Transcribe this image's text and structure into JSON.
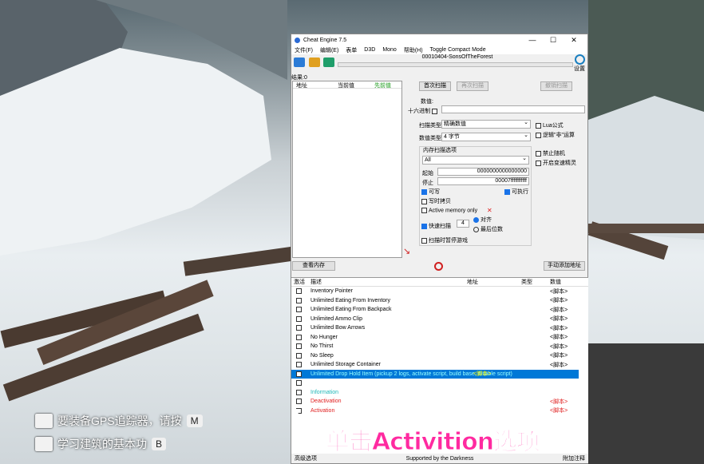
{
  "window": {
    "title": "Cheat Engine 7.5",
    "process": "00010404-SonsOfTheForest"
  },
  "menu": [
    "文件(F)",
    "编辑(E)",
    "表单",
    "D3D",
    "Mono",
    "帮助(H)",
    "Toggle Compact Mode"
  ],
  "settings_label": "设置",
  "found": "结果:0",
  "list_headers": [
    "地址",
    "当前值",
    "先前值"
  ],
  "buttons": {
    "first_scan": "首次扫描",
    "next_scan": "再次扫描",
    "undo_scan": "撤销扫描",
    "memory_view": "查看内存",
    "add_address": "手动添加地址"
  },
  "value_label": "数值:",
  "hex_label": "十六进制",
  "scan_type_label": "扫描类型",
  "scan_type": "精确数值",
  "value_type_label": "数值类型",
  "value_type": "4 字节",
  "mem_options_label": "内存扫描选项",
  "region": "All",
  "start_label": "起始",
  "start_value": "0000000000000000",
  "stop_label": "停止",
  "stop_value": "00007fffffffffff",
  "opts": {
    "writable": "可写",
    "copy_on_write": "写时拷贝",
    "executable": "可执行",
    "active_memory": "Active memory only",
    "fast_scan": "快速扫描",
    "fast_scan_value": "4",
    "align": "对齐",
    "last_digits": "最后位数",
    "pause": "扫描时暂停游戏"
  },
  "right_opts": {
    "lua": "Lua公式",
    "not": "逻辑\"非\"运算",
    "unrandomizer": "禁止随机",
    "speedhack": "开启变速精灵"
  },
  "table_headers": [
    "激活",
    "描述",
    "地址",
    "类型",
    "数值"
  ],
  "rows": [
    {
      "desc": "Inventory Pointer",
      "value": "<脚本>"
    },
    {
      "desc": "Unlimited Eating From Inventory",
      "value": "<脚本>"
    },
    {
      "desc": "Unlimited Eating From Backpack",
      "value": "<脚本>"
    },
    {
      "desc": "Unlimited Ammo Clip",
      "value": "<脚本>"
    },
    {
      "desc": "Unlimited Bow Arrows",
      "value": "<脚本>"
    },
    {
      "desc": "No Hunger",
      "value": "<脚本>"
    },
    {
      "desc": "No Thirst",
      "value": "<脚本>"
    },
    {
      "desc": "No Sleep",
      "value": "<脚本>"
    },
    {
      "desc": "Unlimited Storage Container",
      "value": "<脚本>"
    },
    {
      "desc": "Unlimited Drop Hold Item (pickup 2 logs, activate script, build base, disable script)",
      "value": "<脚本>"
    },
    {
      "desc": "",
      "value": ""
    },
    {
      "desc": "Information",
      "value": ""
    },
    {
      "desc": "Deactivation",
      "value": "<脚本>"
    },
    {
      "desc": "Activation",
      "value": "<脚本>"
    }
  ],
  "status": {
    "left": "高级选项",
    "center": "Supported by the Darkness",
    "right": "附加注释"
  },
  "hints": [
    {
      "text": "要装备GPS追踪器，请按",
      "key": "M"
    },
    {
      "text": "学习建筑的基本功",
      "key": "B"
    }
  ],
  "caption": "单击Activition选项",
  "colors": {
    "info": "#1fb8b8",
    "red": "#e02020",
    "selected": "#0078d7",
    "caption": "#ff2aa0"
  }
}
